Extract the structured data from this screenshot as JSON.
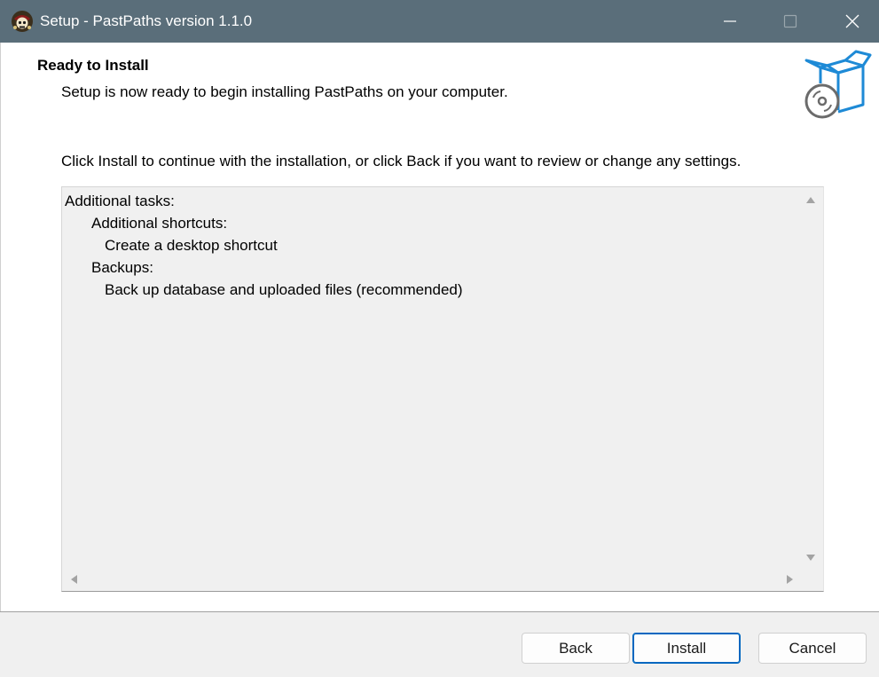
{
  "window": {
    "title": "Setup - PastPaths version 1.1.0",
    "app_icon": "pirate-skull-icon",
    "controls": [
      "minimize-icon",
      "maximize-icon",
      "close-icon"
    ]
  },
  "header": {
    "heading": "Ready to Install",
    "subheading": "Setup is now ready to begin installing PastPaths on your computer.",
    "wizard_image": "box-with-disc-icon"
  },
  "instruction": "Click Install to continue with the installation, or click Back if you want to review or change any settings.",
  "memo": {
    "lines": [
      "Additional tasks:",
      "Additional shortcuts:",
      "Create a desktop shortcut",
      "Backups:",
      "Back up database and uploaded files (recommended)"
    ]
  },
  "buttons": {
    "back": "Back",
    "install": "Install",
    "cancel": "Cancel"
  },
  "colors": {
    "titlebar": "#5a6e7a",
    "accent": "#0067c0",
    "wizard_image_blue": "#1e8ad6"
  }
}
